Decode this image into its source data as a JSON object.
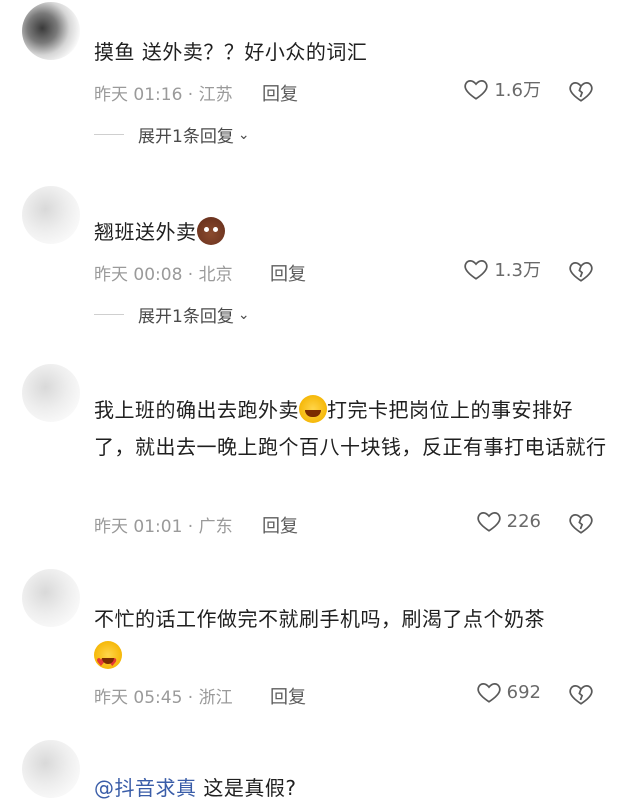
{
  "comments": [
    {
      "username": "",
      "text": "摸鱼 送外卖？？好小众的词汇",
      "time_location": "昨天 01:16 · 江苏",
      "reply_label": "回复",
      "likes": "1.6万",
      "expand_label": "展开1条回复"
    },
    {
      "username": "",
      "text": "翘班送外卖",
      "time_location": "昨天 00:08 · 北京",
      "reply_label": "回复",
      "likes": "1.3万",
      "expand_label": "展开1条回复"
    },
    {
      "username": "",
      "text_part1": "我上班的确出去跑外卖",
      "text_part2": "打完卡把岗位上的事安排好了，就出去一晚上跑个百八十块钱，反正有事打电话就行",
      "time_location": "昨天 01:01 · 广东",
      "reply_label": "回复",
      "likes": "226"
    },
    {
      "username": "",
      "text": "不忙的话工作做完不就刷手机吗，刷渴了点个奶茶",
      "time_location": "昨天 05:45 · 浙江",
      "reply_label": "回复",
      "likes": "692"
    },
    {
      "username": "",
      "mention": "@抖音求真",
      "text": " 这是真假?"
    }
  ],
  "icons": {
    "like": "heart-outline-icon",
    "dislike": "broken-heart-icon",
    "expand": "chevron-down-icon"
  }
}
